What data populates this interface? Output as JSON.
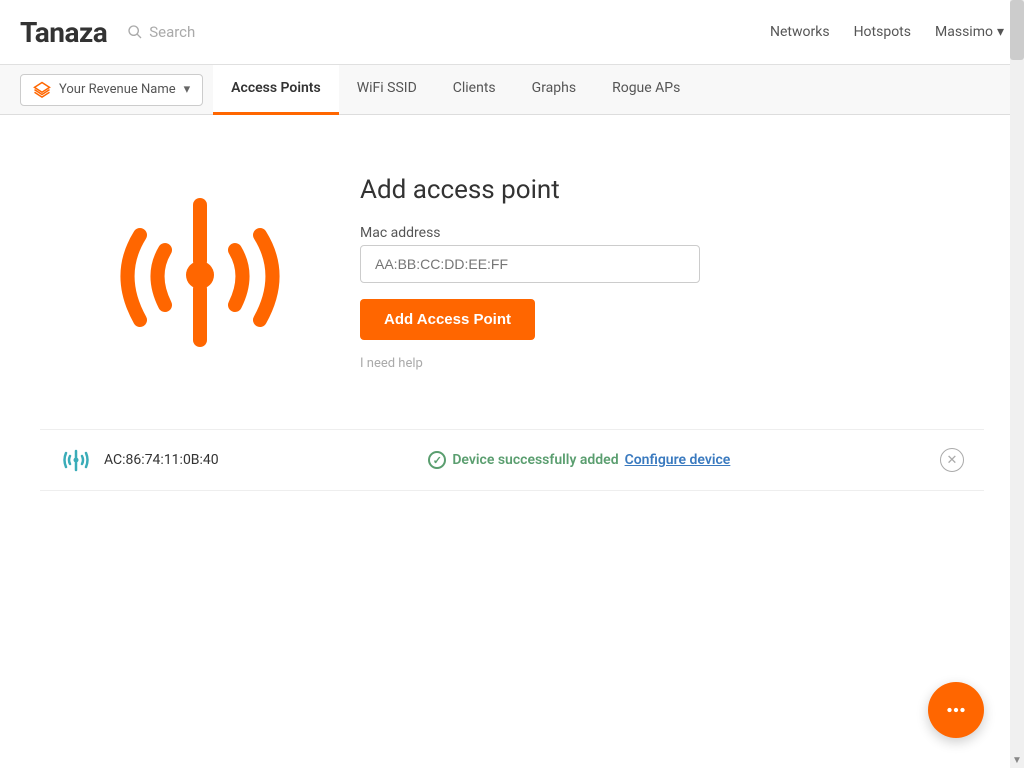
{
  "header": {
    "logo": "Tanaza",
    "search_placeholder": "Search",
    "nav_items": [
      {
        "label": "Networks",
        "id": "networks"
      },
      {
        "label": "Hotspots",
        "id": "hotspots"
      },
      {
        "label": "Massimo",
        "id": "user",
        "has_dropdown": true
      }
    ]
  },
  "subnav": {
    "org_selector": {
      "label": "Your Revenue Name",
      "icon": "layers-icon"
    },
    "tabs": [
      {
        "label": "Access Points",
        "id": "access-points",
        "active": true
      },
      {
        "label": "WiFi SSID",
        "id": "wifi-ssid",
        "active": false
      },
      {
        "label": "Clients",
        "id": "clients",
        "active": false
      },
      {
        "label": "Graphs",
        "id": "graphs",
        "active": false
      },
      {
        "label": "Rogue APs",
        "id": "rogue-aps",
        "active": false
      }
    ]
  },
  "main": {
    "form": {
      "title": "Add access point",
      "mac_label": "Mac address",
      "mac_placeholder": "AA:BB:CC:DD:EE:FF",
      "submit_label": "Add Access Point",
      "help_label": "I need help"
    },
    "success": {
      "device_mac": "AC:86:74:11:0B:40",
      "message": "Device successfully added",
      "configure_label": "Configure device"
    }
  },
  "colors": {
    "orange": "#ff6600",
    "teal": "#3aacb8",
    "green": "#5a9e6f",
    "blue": "#3a7abf"
  },
  "chat_button": {
    "icon": "chat-icon"
  }
}
